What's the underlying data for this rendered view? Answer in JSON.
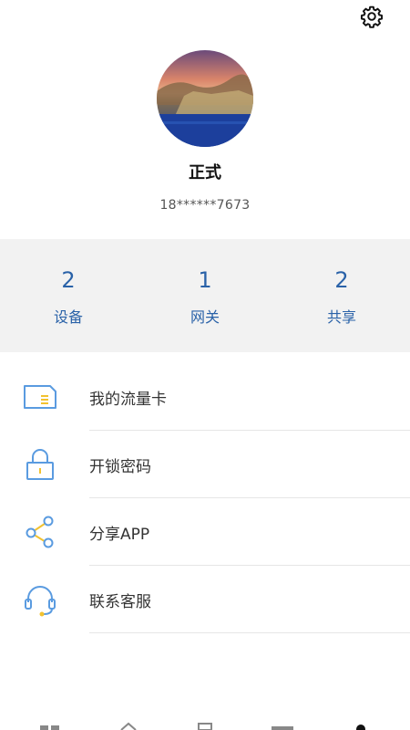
{
  "profile": {
    "name": "正式",
    "phone": "18******7673"
  },
  "stats": [
    {
      "value": "2",
      "label": "设备"
    },
    {
      "value": "1",
      "label": "网关"
    },
    {
      "value": "2",
      "label": "共享"
    }
  ],
  "menu": [
    {
      "label": "我的流量卡",
      "icon": "sim-card-icon"
    },
    {
      "label": "开锁密码",
      "icon": "lock-icon"
    },
    {
      "label": "分享APP",
      "icon": "share-icon"
    },
    {
      "label": "联系客服",
      "icon": "headset-icon"
    }
  ],
  "colors": {
    "accent": "#2a62a8",
    "icon_blue": "#5a9be0",
    "icon_yellow": "#f2c230",
    "stats_bg": "#f2f2f2"
  },
  "settings_icon": "gear-icon",
  "bottom_nav_icons": [
    "grid-icon",
    "home-icon",
    "device-icon",
    "card-icon",
    "profile-icon"
  ]
}
